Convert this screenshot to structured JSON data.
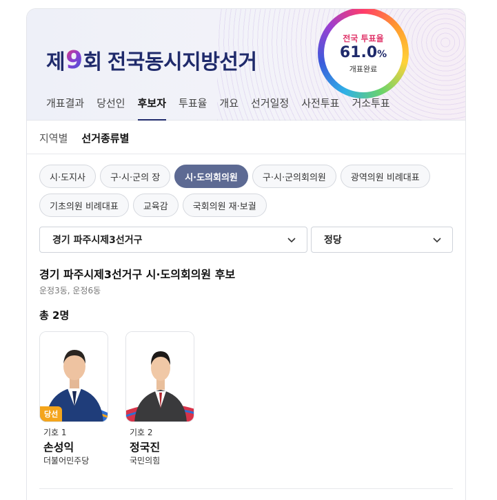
{
  "banner": {
    "title_prefix": "제",
    "title_number": "9",
    "title_mid": "회",
    "title_suffix": "전국동시지방선거",
    "turnout_label": "전국 투표율",
    "turnout_value": "61.0",
    "turnout_unit": "%",
    "count_status": "개표완료"
  },
  "main_tabs": [
    "개표결과",
    "당선인",
    "후보자",
    "투표율",
    "개요",
    "선거일정",
    "사전투표",
    "거소투표"
  ],
  "main_tab_active": "후보자",
  "sub_tabs": [
    "지역별",
    "선거종류별"
  ],
  "sub_tab_active": "선거종류별",
  "chips": [
    [
      "시·도지사",
      "구·시·군의 장",
      "시·도의회의원",
      "구·시·군의회의원",
      "광역의원 비례대표"
    ],
    [
      "기초의원 비례대표",
      "교육감",
      "국회의원 재·보궐"
    ]
  ],
  "chip_active": "시·도의회의원",
  "filters": {
    "district": "경기 파주시제3선거구",
    "party": "정당"
  },
  "result": {
    "heading": "경기 파주시제3선거구 시·도의회의원 후보",
    "dongs": "운정3동, 운정6동",
    "total": "총 2명"
  },
  "candidates": [
    {
      "number": "기호 1",
      "name": "손성익",
      "party": "더불어민주당",
      "badge": "당선"
    },
    {
      "number": "기호 2",
      "name": "정국진",
      "party": "국민의힘",
      "badge": ""
    }
  ],
  "colors": {
    "brand_navy": "#1f2a6b",
    "chip_active": "#5d6a93",
    "elected_badge": "#f4a51c"
  },
  "icons": {
    "dropdown": "chevron-down-icon"
  }
}
